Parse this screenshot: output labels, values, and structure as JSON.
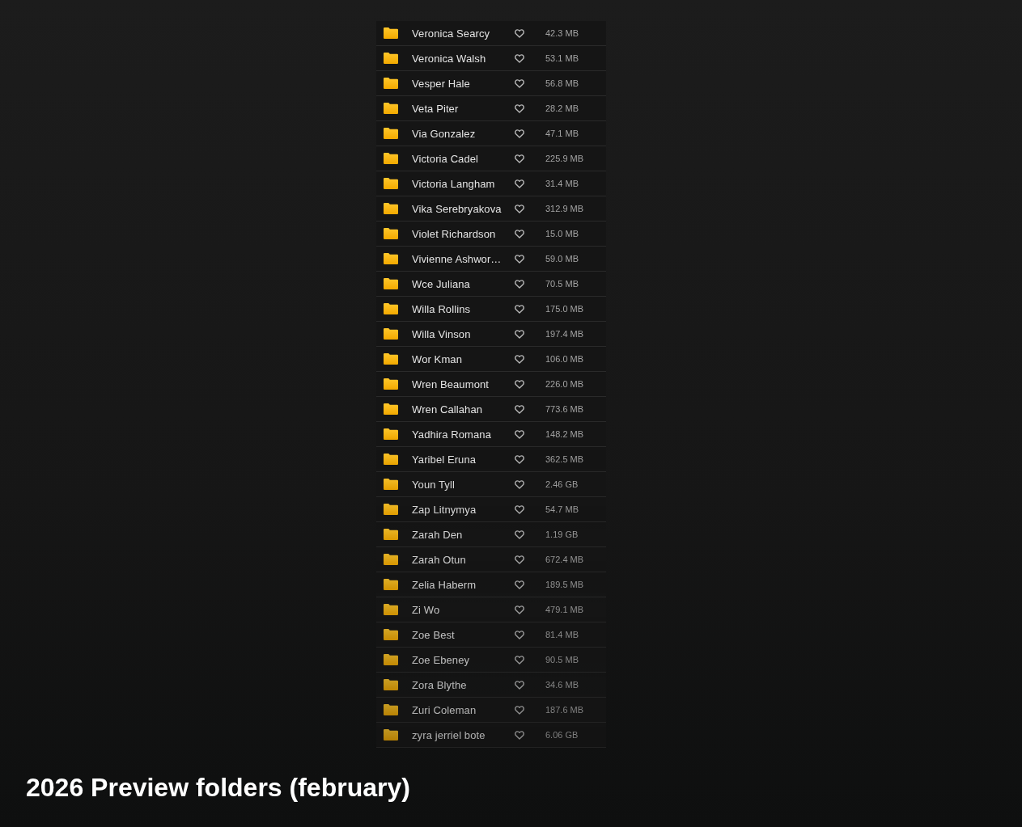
{
  "folders": [
    {
      "name": "Veronica Searcy",
      "favorite": false,
      "size": "42.3 MB"
    },
    {
      "name": "Veronica Walsh",
      "favorite": false,
      "size": "53.1 MB"
    },
    {
      "name": "Vesper Hale",
      "favorite": false,
      "size": "56.8 MB"
    },
    {
      "name": "Veta Piter",
      "favorite": false,
      "size": "28.2 MB"
    },
    {
      "name": "Via Gonzalez",
      "favorite": false,
      "size": "47.1 MB"
    },
    {
      "name": "Victoria Cadel",
      "favorite": false,
      "size": "225.9 MB"
    },
    {
      "name": "Victoria Langham",
      "favorite": false,
      "size": "31.4 MB"
    },
    {
      "name": "Vika Serebryakova",
      "favorite": false,
      "size": "312.9 MB"
    },
    {
      "name": "Violet Richardson",
      "favorite": false,
      "size": "15.0 MB"
    },
    {
      "name": "Vivienne Ashwor…",
      "favorite": false,
      "size": "59.0 MB"
    },
    {
      "name": "Wce Juliana",
      "favorite": false,
      "size": "70.5 MB"
    },
    {
      "name": "Willa Rollins",
      "favorite": false,
      "size": "175.0 MB"
    },
    {
      "name": "Willa Vinson",
      "favorite": false,
      "size": "197.4 MB"
    },
    {
      "name": "Wor Kman",
      "favorite": false,
      "size": "106.0 MB"
    },
    {
      "name": "Wren Beaumont",
      "favorite": false,
      "size": "226.0 MB"
    },
    {
      "name": "Wren Callahan",
      "favorite": false,
      "size": "773.6 MB"
    },
    {
      "name": "Yadhira Romana",
      "favorite": false,
      "size": "148.2 MB"
    },
    {
      "name": "Yaribel Eruna",
      "favorite": false,
      "size": "362.5 MB"
    },
    {
      "name": "Youn Tyll",
      "favorite": false,
      "size": "2.46 GB"
    },
    {
      "name": "Zap Litnymya",
      "favorite": false,
      "size": "54.7 MB"
    },
    {
      "name": "Zarah Den",
      "favorite": false,
      "size": "1.19 GB"
    },
    {
      "name": "Zarah Otun",
      "favorite": false,
      "size": "672.4 MB"
    },
    {
      "name": "Zelia Haberm",
      "favorite": false,
      "size": "189.5 MB"
    },
    {
      "name": "Zi Wo",
      "favorite": false,
      "size": "479.1 MB"
    },
    {
      "name": "Zoe Best",
      "favorite": false,
      "size": "81.4 MB"
    },
    {
      "name": "Zoe Ebeney",
      "favorite": false,
      "size": "90.5 MB"
    },
    {
      "name": "Zora Blythe",
      "favorite": false,
      "size": "34.6 MB"
    },
    {
      "name": "Zuri Coleman",
      "favorite": false,
      "size": "187.6 MB"
    },
    {
      "name": "zyra jerriel bote",
      "favorite": false,
      "size": "6.06 GB"
    }
  ],
  "caption": "2026 Preview folders (february)"
}
